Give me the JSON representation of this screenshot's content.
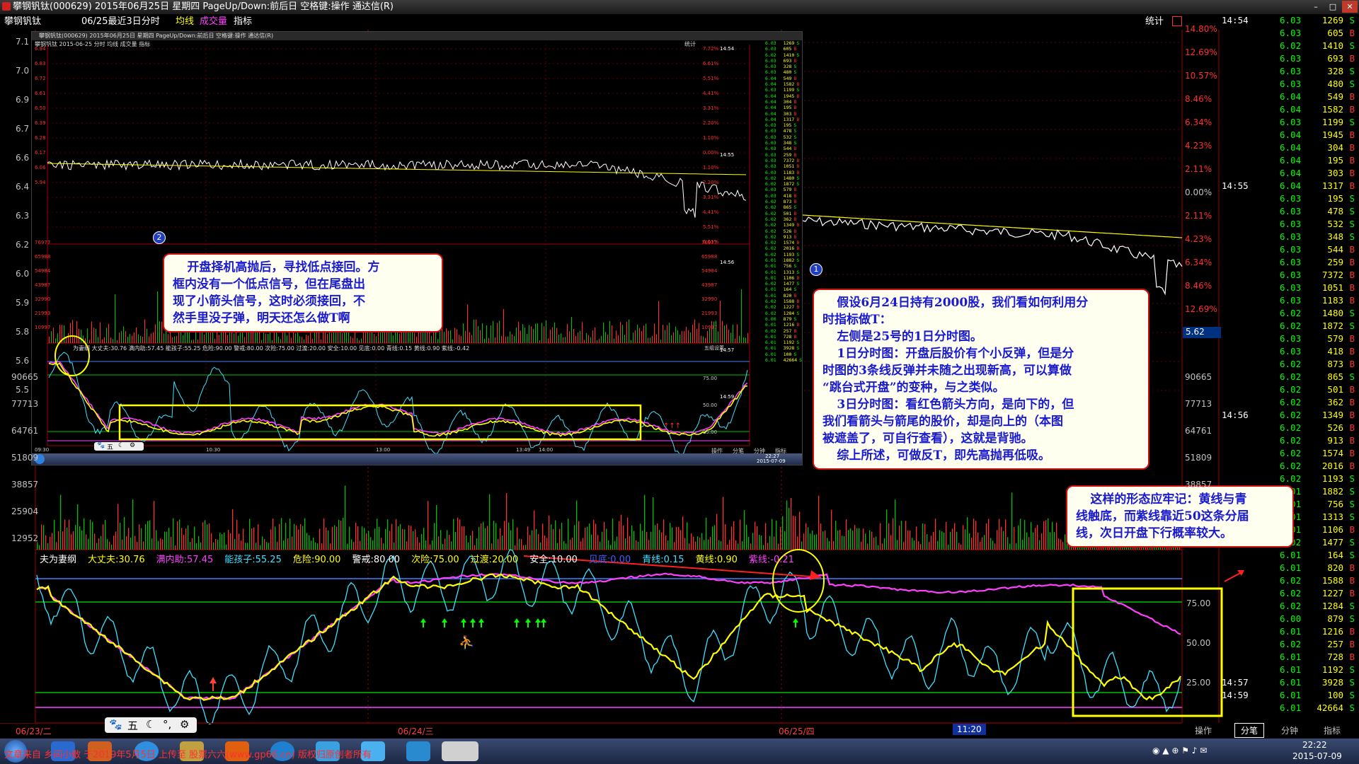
{
  "window": {
    "title": "攀钢钒钛(000629) 2015年06月25日 星期四 PageUp/Down:前后日 空格键:操作 通达信(R)"
  },
  "infobar": {
    "name": "攀钢钒钛",
    "desc": "06/25最近3日分时",
    "ma_label": "均线",
    "vol_label": "成交量",
    "ind_label": "指标",
    "stats_label": "统计"
  },
  "left_price_axis": [
    "7.1",
    "7.0",
    "6.9",
    "6.7",
    "6.6",
    "6.4",
    "6.3",
    "6.2",
    "6.0",
    "5.9",
    "5.8",
    "5.6",
    "5.5"
  ],
  "left_volume_axis": [
    "90665",
    "77713",
    "64761",
    "51809",
    "38857",
    "25904",
    "12952"
  ],
  "right_pct_axis": [
    "14.80%",
    "12.69%",
    "10.57%",
    "8.46%",
    "6.34%",
    "4.23%",
    "2.11%",
    "0.00%",
    "2.11%",
    "4.23%",
    "6.34%",
    "8.46%",
    "12.69%"
  ],
  "right_volume_axis": [
    "90665",
    "77713",
    "64761",
    "51809",
    "38857"
  ],
  "right_ind_axis": [
    "75.00",
    "50.00",
    "25.00"
  ],
  "price_marker": "5.62",
  "indicator_legend": {
    "items": [
      {
        "label": "夫为妻纲",
        "value": "",
        "color": "#ffffff"
      },
      {
        "label": "大丈夫:",
        "value": "30.76",
        "color": "#ffff00"
      },
      {
        "label": "满内助:",
        "value": "57.45",
        "color": "#ff40ff"
      },
      {
        "label": "能孩子:",
        "value": "55.25",
        "color": "#40e0ff"
      },
      {
        "label": "危险:",
        "value": "90.00",
        "color": "#ffff00"
      },
      {
        "label": "警戒:",
        "value": "80.00",
        "color": "#ffffff"
      },
      {
        "label": "次险:",
        "value": "75.00",
        "color": "#ffff00"
      },
      {
        "label": "过渡:",
        "value": "20.00",
        "color": "#ffff00"
      },
      {
        "label": "安全:",
        "value": "10.00",
        "color": "#ffffff"
      },
      {
        "label": "见底:",
        "value": "0.00",
        "color": "#4060ff"
      },
      {
        "label": "青线:",
        "value": "0.15",
        "color": "#40e0ff"
      },
      {
        "label": "黄线:",
        "value": "0.90",
        "color": "#ffff00"
      },
      {
        "label": "紫线:",
        "value": "-0.21",
        "color": "#ff40ff"
      }
    ]
  },
  "dates": [
    "06/23/二",
    "06/24/三",
    "06/25/四",
    "11:20"
  ],
  "bottom_tabs": [
    "操作",
    "分笔",
    "分钟",
    "指标"
  ],
  "quotes": {
    "blocks": [
      {
        "time": "14:54",
        "rows": [
          [
            "6.03",
            "1269",
            "S"
          ],
          [
            "6.03",
            "605",
            "B"
          ],
          [
            "6.02",
            "1410",
            "S"
          ],
          [
            "6.03",
            "693",
            "B"
          ],
          [
            "6.03",
            "328",
            "S"
          ],
          [
            "6.03",
            "480",
            "S"
          ],
          [
            "6.04",
            "549",
            "B"
          ],
          [
            "6.04",
            "1582",
            "B"
          ],
          [
            "6.03",
            "1199",
            "S"
          ],
          [
            "6.04",
            "1945",
            "B"
          ],
          [
            "6.04",
            "304",
            "B"
          ],
          [
            "6.04",
            "195",
            "B"
          ],
          [
            "6.04",
            "303",
            "B"
          ]
        ]
      },
      {
        "time": "14:55",
        "rows": [
          [
            "6.04",
            "1317",
            "B"
          ],
          [
            "6.03",
            "195",
            "S"
          ],
          [
            "6.03",
            "478",
            "S"
          ],
          [
            "6.03",
            "532",
            "S"
          ],
          [
            "6.03",
            "348",
            "S"
          ],
          [
            "6.03",
            "544",
            "B"
          ],
          [
            "6.03",
            "259",
            "B"
          ],
          [
            "6.03",
            "7372",
            "B"
          ],
          [
            "6.03",
            "1051",
            "B"
          ],
          [
            "6.03",
            "1183",
            "B"
          ],
          [
            "6.02",
            "1480",
            "S"
          ],
          [
            "6.02",
            "1872",
            "S"
          ],
          [
            "6.03",
            "579",
            "B"
          ],
          [
            "6.03",
            "418",
            "B"
          ],
          [
            "6.02",
            "873",
            "B"
          ],
          [
            "6.02",
            "865",
            "S"
          ],
          [
            "6.02",
            "501",
            "B"
          ],
          [
            "6.02",
            "362",
            "B"
          ]
        ]
      },
      {
        "time": "14:56",
        "rows": [
          [
            "6.02",
            "1349",
            "B"
          ],
          [
            "6.02",
            "526",
            "B"
          ],
          [
            "6.02",
            "913",
            "B"
          ],
          [
            "6.02",
            "1574",
            "B"
          ],
          [
            "6.02",
            "2016",
            "B"
          ],
          [
            "6.02",
            "1193",
            "S"
          ],
          [
            "6.01",
            "1882",
            "S"
          ],
          [
            "6.01",
            "756",
            "S"
          ],
          [
            "6.01",
            "1313",
            "S"
          ],
          [
            "6.01",
            "1106",
            "B"
          ],
          [
            "6.02",
            "1477",
            "S"
          ],
          [
            "6.01",
            "164",
            "S"
          ],
          [
            "6.01",
            "820",
            "B"
          ],
          [
            "6.02",
            "1588",
            "B"
          ],
          [
            "6.02",
            "1227",
            "B"
          ],
          [
            "6.02",
            "1284",
            "S"
          ],
          [
            "6.00",
            "879",
            "S"
          ],
          [
            "6.01",
            "1216",
            "B"
          ],
          [
            "6.02",
            "257",
            "B"
          ],
          [
            "6.01",
            "728",
            "B"
          ],
          [
            "6.01",
            "1192",
            "S"
          ]
        ]
      },
      {
        "time": "14:57",
        "rows": [
          [
            "6.01",
            "3928",
            "S"
          ]
        ]
      },
      {
        "time": "14:59",
        "rows": [
          [
            "6.01",
            "100",
            "S"
          ],
          [
            "6.01",
            "42664",
            "S"
          ]
        ]
      }
    ]
  },
  "callouts": {
    "left": [
      "开盘择机高抛后，寻找低点接回。方",
      "框内没有一个低点信号，但在尾盘出",
      "现了小箭头信号，这时必须接回，不",
      "然手里没子弹，明天还怎么做T啊"
    ],
    "center": [
      "假设6月24日持有2000股，我们看如何利用分",
      "时指标做T：",
      "左侧是25号的1日分时图。",
      "1日分时图：开盘后股价有个小反弹，但是分",
      "时图的3条线反弹并未随之出现新高，可以算做",
      "“跳台式开盘”的变种，与之类似。",
      "3日分时图：看红色箭头方向，是向下的，但",
      "我们看箭头与箭尾的股价，却是向上的（本图",
      "被遮盖了，可自行查看），这就是背驰。",
      "综上所述，可做反T，即先高抛再低吸。"
    ],
    "right": [
      "这样的形态应牢记：黄线与青",
      "线触底，而紫线靠近50这条分届",
      "线，次日开盘下行概率较大。"
    ]
  },
  "markers": {
    "one": "1",
    "two": "2"
  },
  "inner_window": {
    "title": "攀钢钒钛(000629) 2015年06月25日 星期四 PageUp/Down:前后日 空格键:操作 通达信(R)",
    "sub": "攀钢钒钛  2015-06-25 分时  均线 成交量 指标",
    "stats": "统计",
    "pct_axis": [
      "7.72%",
      "6.61%",
      "5.51%",
      "4.41%",
      "3.31%",
      "2.20%",
      "1.10%",
      "0.00%",
      "1.10%",
      "2.20%",
      "3.31%",
      "4.41%",
      "5.51%",
      "6.61%"
    ],
    "price_axis": [
      "6.94",
      "6.83",
      "6.72",
      "6.61",
      "6.50",
      "6.39",
      "6.28",
      "6.17",
      "6.06",
      "5.94"
    ],
    "vol_axis": [
      "76977",
      "65988",
      "54984",
      "43987",
      "32990",
      "21993",
      "10997"
    ],
    "ind_legend": "为妻纲 大丈夫:30.76 满内助:57.45 能孩子:55.25 危险:90.00 警戒:80.00 次险:75.00 过渡:20.00 安全:10.00 见底:0.00 青线:0.15 黄线:0.90 紫线:-0.42",
    "ind_axis": [
      "75.00",
      "50.00",
      "25.00"
    ],
    "time_axis": [
      "09:30",
      "10:30",
      "13:00",
      "13:49",
      "14:00"
    ],
    "times": [
      "14:54",
      "14:55",
      "14:56",
      "14:57",
      "14:59"
    ],
    "tabs": [
      "操作",
      "分笔",
      "分钟",
      "指标"
    ],
    "clock": "22:27",
    "clock_date": "2015-07-09",
    "indicator_tag": "五组设置"
  },
  "taskbar": {
    "ticker": "文章来自 乡间小散 于2019年5月5日 上传至 股票六六(www.gp66.cn) 版权归原创者所有",
    "clock_time": "22:22",
    "clock_date": "2015-07-09"
  },
  "toolbar_small": [
    "五"
  ],
  "colors": {
    "price_line": "#ffffff",
    "avg_line": "#ffff00",
    "yellow_line": "#ffff00",
    "cyan_line": "#40e0ff",
    "magenta_line": "#ff40ff",
    "up": "#ff3030",
    "down": "#00ff00",
    "highlight_box": "#ffff00"
  }
}
